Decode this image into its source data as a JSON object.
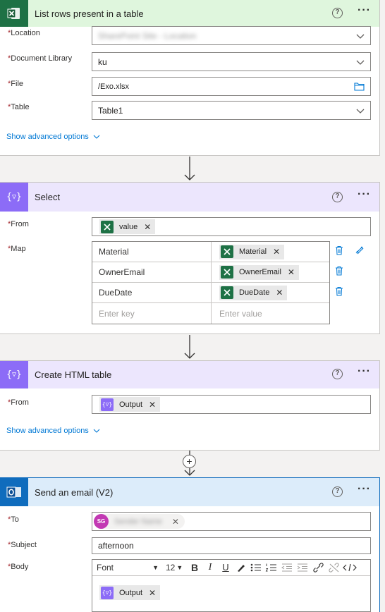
{
  "list_rows_card": {
    "title": "List rows present in a table",
    "fields": {
      "location_label": "Location",
      "location_value": "SharePoint Site - Location",
      "library_label": "Document Library",
      "library_value": "ku",
      "file_label": "File",
      "file_value": "/Exo.xlsx",
      "table_label": "Table",
      "table_value": "Table1"
    },
    "advanced": "Show advanced options"
  },
  "select_card": {
    "title": "Select",
    "from_label": "From",
    "from_token": "value",
    "map_label": "Map",
    "map_rows": [
      {
        "key": "Material",
        "value": "Material"
      },
      {
        "key": "OwnerEmail",
        "value": "OwnerEmail"
      },
      {
        "key": "DueDate",
        "value": "DueDate"
      }
    ],
    "key_placeholder": "Enter key",
    "value_placeholder": "Enter value"
  },
  "html_card": {
    "title": "Create HTML table",
    "from_label": "From",
    "from_token": "Output",
    "advanced": "Show advanced options"
  },
  "email_card": {
    "title": "Send an email (V2)",
    "to_label": "To",
    "to_initials": "SG",
    "to_name": "Sender Name",
    "subject_label": "Subject",
    "subject_value": "afternoon",
    "body_label": "Body",
    "font_name": "Font",
    "font_size": "12",
    "body_token": "Output"
  },
  "required_marker": "*",
  "colors": {
    "excel_header": "#dff6dd",
    "excel_brand": "#1e7145",
    "select_header": "#ece6fd",
    "select_brand": "#8c6cf7",
    "outlook_header": "#dcecfa",
    "outlook_brand": "#0f6cbd",
    "link": "#0078d4",
    "avatar": "#c239b3"
  }
}
